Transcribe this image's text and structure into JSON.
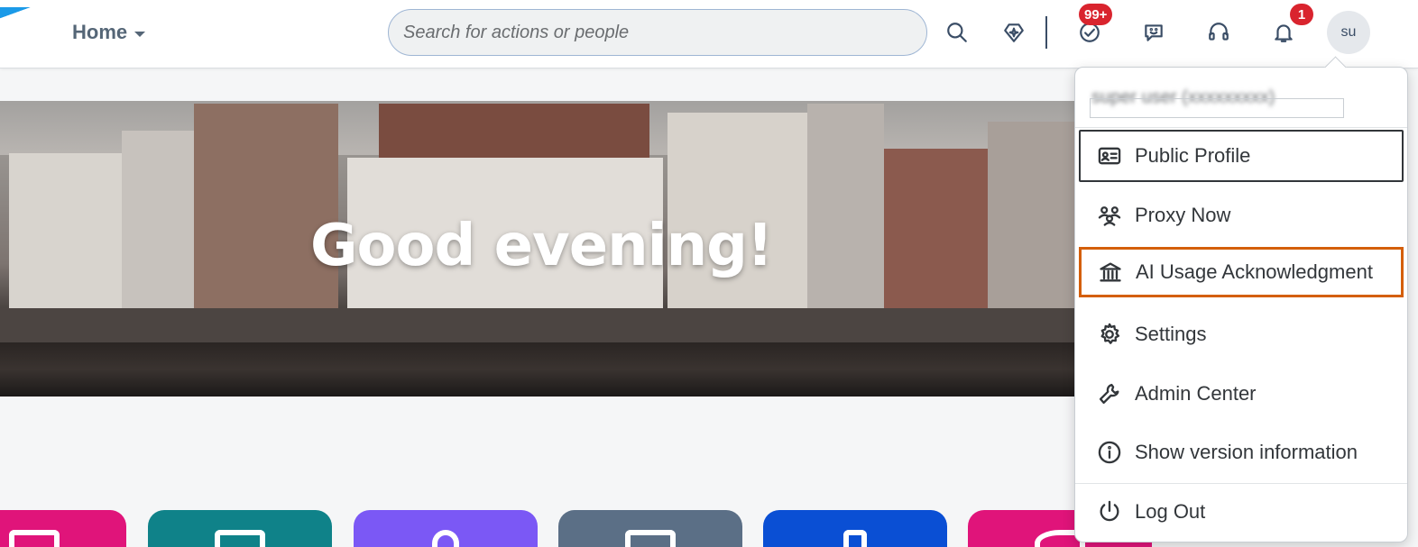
{
  "header": {
    "home_label": "Home",
    "search_placeholder": "Search for actions or people",
    "tasks_badge": "99+",
    "notifications_badge": "1",
    "avatar_initials": "su"
  },
  "hero": {
    "greeting": "Good evening!"
  },
  "user_menu": {
    "user_name": "super user (xxxxxxxxx)",
    "items": [
      {
        "label": "Public Profile",
        "icon": "profile-card-icon"
      },
      {
        "label": "Proxy Now",
        "icon": "proxy-users-icon"
      },
      {
        "label": "AI Usage Acknowledgment",
        "icon": "institution-icon"
      },
      {
        "label": "Settings",
        "icon": "gear-icon"
      },
      {
        "label": "Admin Center",
        "icon": "wrench-icon"
      },
      {
        "label": "Show version information",
        "icon": "info-icon"
      },
      {
        "label": "Log Out",
        "icon": "power-icon"
      }
    ]
  },
  "colors": {
    "badge_red": "#d9242e",
    "highlight_orange": "#d45f0a",
    "tile_colors": [
      "#e0147a",
      "#0f8289",
      "#7b58f5",
      "#5b6f86",
      "#0a4fd4",
      "#e0147a"
    ]
  }
}
